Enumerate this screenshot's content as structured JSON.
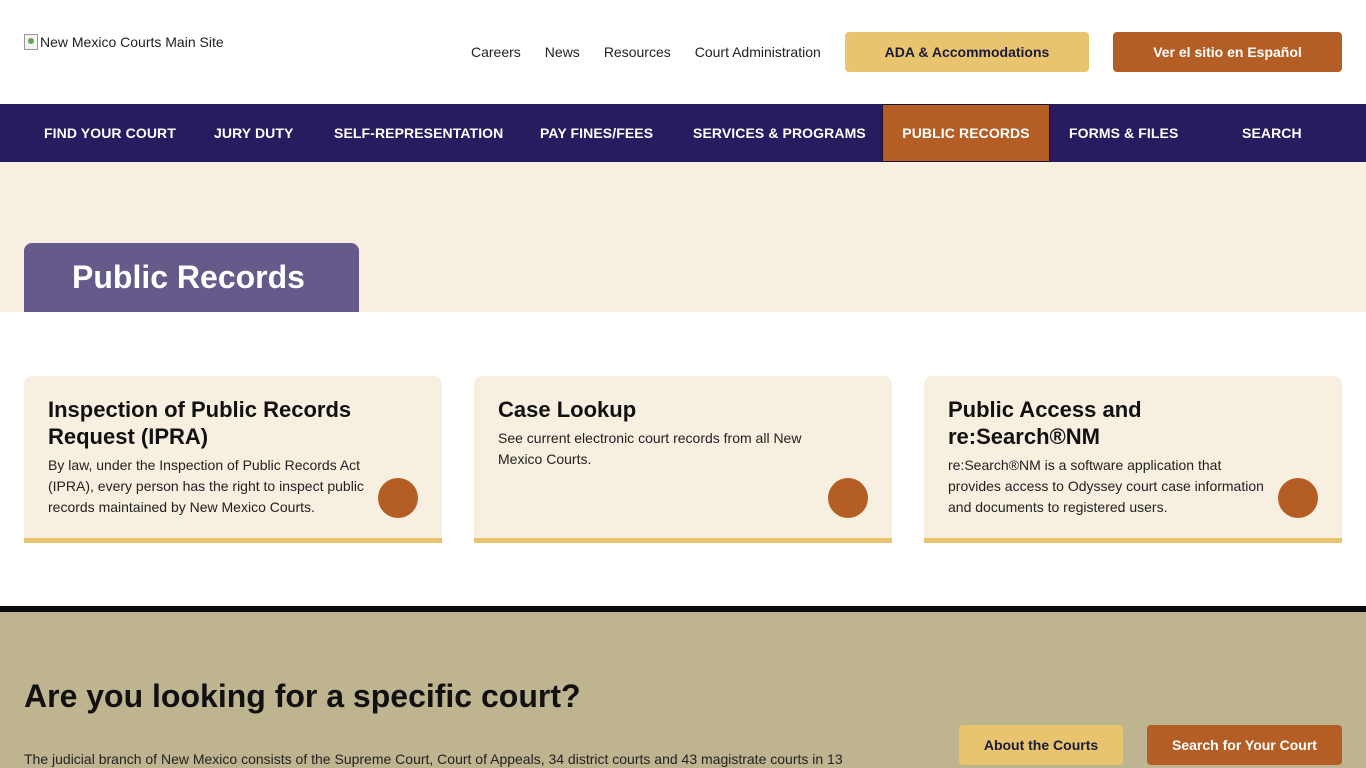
{
  "header": {
    "logo_alt": "New Mexico Courts Main Site",
    "utility_links": [
      "Careers",
      "News",
      "Resources",
      "Court Administration"
    ],
    "ada_button": "ADA & Accommodations",
    "spanish_button": "Ver el sitio en Español"
  },
  "mainnav": {
    "items": [
      "FIND YOUR COURT",
      "JURY DUTY",
      "SELF-REPRESENTATION",
      "PAY FINES/FEES",
      "SERVICES & PROGRAMS",
      "PUBLIC RECORDS",
      "FORMS & FILES",
      "SEARCH"
    ],
    "active": "PUBLIC RECORDS"
  },
  "hero": {
    "title": "Public Records"
  },
  "cards": [
    {
      "title": "Inspection of Public Records Request (IPRA)",
      "body": "By law, under the Inspection of Public Records Act (IPRA), every person has the right to inspect public records maintained by New Mexico Courts."
    },
    {
      "title": "Case Lookup",
      "body": "See current electronic court records from all New Mexico Courts."
    },
    {
      "title": "Public Access and re:Search®NM",
      "body": "re:Search®NM is a software application that provides access to Odyssey court case information and documents to registered users."
    }
  ],
  "bottom": {
    "heading": "Are you looking for a specific court?",
    "text": "The judicial branch of New Mexico consists of the Supreme Court, Court of Appeals, 34 district courts and 43 magistrate courts in 13",
    "about_button": "About the Courts",
    "search_button": "Search for Your Court"
  },
  "colors": {
    "nav_bg": "#281b5f",
    "accent_orange": "#b45e26",
    "accent_gold": "#e8c46e",
    "cream": "#f7efdf",
    "hero_title_bg": "#655a8a",
    "bottom_bg": "#bfb490"
  },
  "icons": [
    "broken-image-icon",
    "arrow-circle-icon"
  ]
}
